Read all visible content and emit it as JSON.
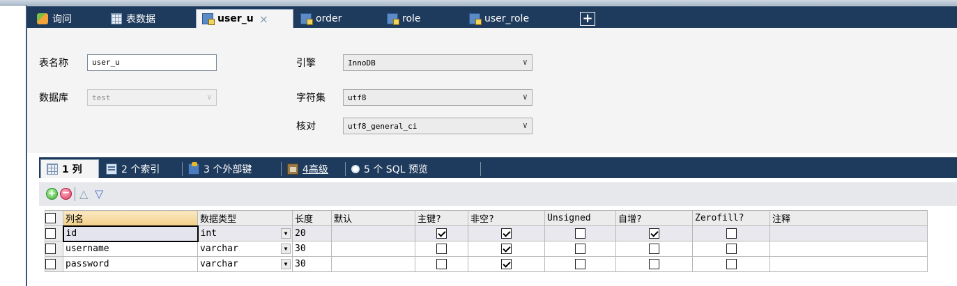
{
  "tabs": [
    {
      "label": "询问",
      "icon": "query-icon"
    },
    {
      "label": "表数据",
      "icon": "table-data-icon"
    },
    {
      "label": "user_u",
      "icon": "table-design-icon",
      "active": true,
      "closable": true
    },
    {
      "label": "order",
      "icon": "table-design-icon"
    },
    {
      "label": "role",
      "icon": "table-design-icon"
    },
    {
      "label": "user_role",
      "icon": "table-design-icon"
    }
  ],
  "new_tab_symbol": "+",
  "close_symbol": "×",
  "props": {
    "table_name_label": "表名称",
    "table_name_value": "user_u",
    "database_label": "数据库",
    "database_value": "test",
    "engine_label": "引擎",
    "engine_value": "InnoDB",
    "charset_label": "字符集",
    "charset_value": "utf8",
    "collation_label": "核对",
    "collation_value": "utf8_general_ci"
  },
  "subtabs": [
    {
      "label": "1 列",
      "icon": "columns-icon",
      "active": true
    },
    {
      "label": "2 个索引",
      "icon": "index-icon"
    },
    {
      "label": "3 个外部键",
      "icon": "foreign-key-icon"
    },
    {
      "label": "4高级",
      "icon": "advanced-icon"
    },
    {
      "label": "5 个 SQL 预览",
      "icon": "sql-preview-icon"
    }
  ],
  "toolbar": {
    "add_symbol": "+",
    "delete_symbol": "−",
    "up_symbol": "△",
    "down_symbol": "▽"
  },
  "grid": {
    "headers": [
      "列名",
      "数据类型",
      "长度",
      "默认",
      "主键?",
      "非空?",
      "Unsigned",
      "自增?",
      "Zerofill?",
      "注释"
    ],
    "rows": [
      {
        "name": "id",
        "type": "int",
        "length": "20",
        "default": "",
        "pk": true,
        "not_null": true,
        "unsigned": false,
        "auto_inc": true,
        "zerofill": false,
        "comment": ""
      },
      {
        "name": "username",
        "type": "varchar",
        "length": "30",
        "default": "",
        "pk": false,
        "not_null": true,
        "unsigned": false,
        "auto_inc": false,
        "zerofill": false,
        "comment": ""
      },
      {
        "name": "password",
        "type": "varchar",
        "length": "30",
        "default": "",
        "pk": false,
        "not_null": true,
        "unsigned": false,
        "auto_inc": false,
        "zerofill": false,
        "comment": ""
      }
    ],
    "dropdown_symbol": "▼"
  }
}
